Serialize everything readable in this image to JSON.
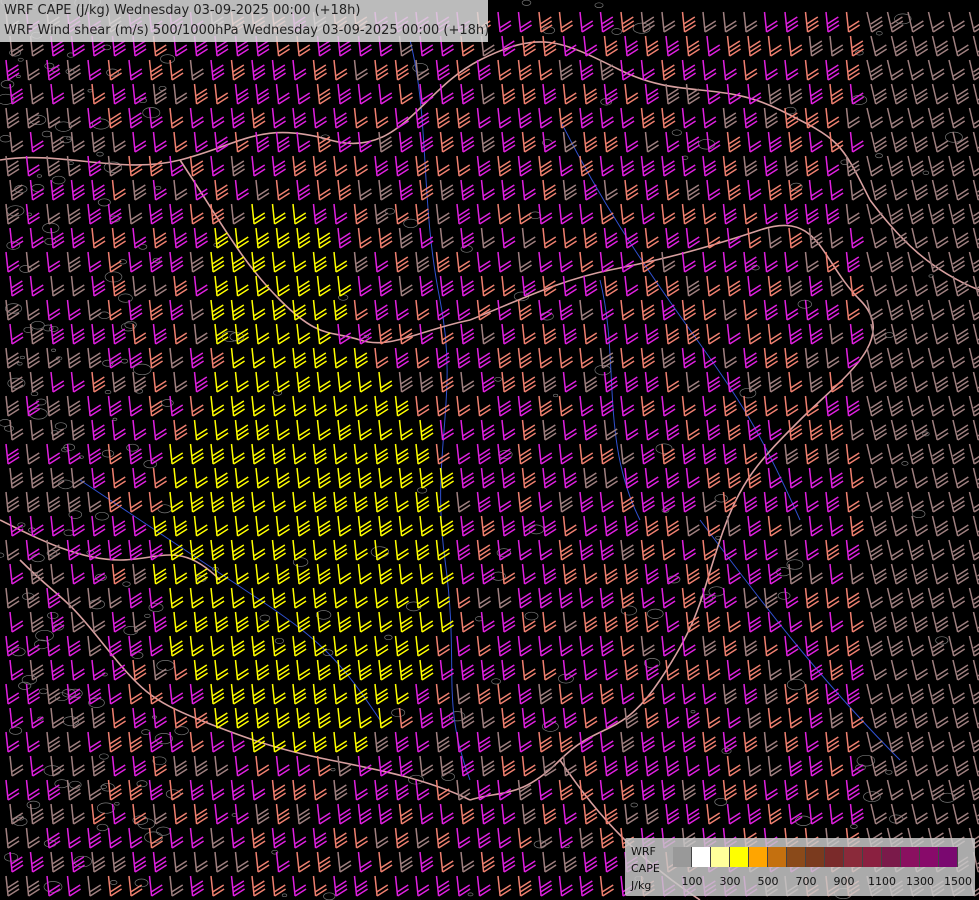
{
  "header": {
    "line1": "WRF CAPE (J/kg) Wednesday 03-09-2025 00:00 (+18h)",
    "line2": "WRF Wind shear (m/s) 500/1000hPa Wednesday 03-09-2025 00:00 (+18h)"
  },
  "legend": {
    "model": "WRF",
    "field": "CAPE",
    "unit": "J/kg",
    "tick_labels": [
      "100",
      "300",
      "500",
      "700",
      "900",
      "1100",
      "1300",
      "1500"
    ],
    "colors": [
      "#999999",
      "#ffffff",
      "#ffff9a",
      "#ffff00",
      "#ffa500",
      "#c4700f",
      "#8a4a1a",
      "#7a3a1e",
      "#7a2a2a",
      "#8a2a3a",
      "#8a2040",
      "#7a1a4a",
      "#8a1060",
      "#880a6a",
      "#7a0870"
    ]
  },
  "map_colors": {
    "background": "#000000",
    "barb_magenta": "#e020e0",
    "barb_salmon": "#f08070",
    "barb_taupe": "#a08080",
    "barb_yellow": "#ffff00",
    "rivers": "#3050d0",
    "borders": "#d8a0a0"
  }
}
